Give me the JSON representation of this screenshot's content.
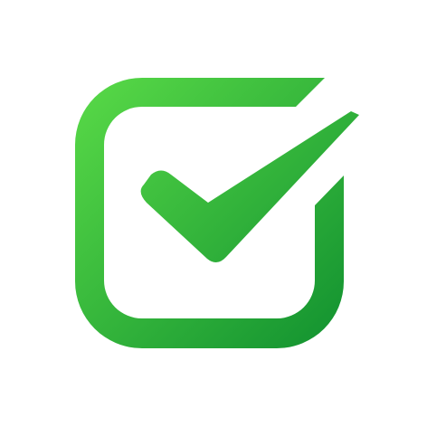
{
  "icon": {
    "name": "checkbox-check-icon",
    "colors": {
      "gradient_start": "#58D947",
      "gradient_end": "#129230",
      "background": "#FFFFFF"
    }
  }
}
